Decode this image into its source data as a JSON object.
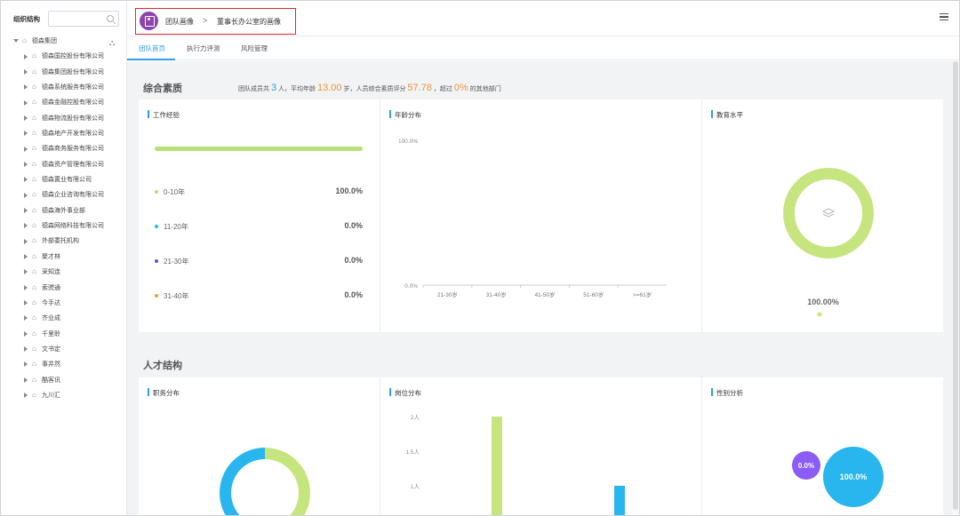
{
  "colors": {
    "accent": "#2aa0e6",
    "green": "#b8e079",
    "cyan": "#29b6ee",
    "purple": "#8b5cf6",
    "orange": "#f0a030",
    "avatar": "#8e44ad"
  },
  "sidebar": {
    "title": "组织结构",
    "search_placeholder": "",
    "root": "德森集团",
    "items": [
      "德森国控股份有限公司",
      "德森集团股份有限公司",
      "德森系统服务有限公司",
      "德森金融控股有限公司",
      "德森物流股份有限公司",
      "德森地产开发有限公司",
      "德森商务服务有限公司",
      "德森资产管理有限公司",
      "德森置业有限公司",
      "德森企业咨询有限公司",
      "德森海外事业部",
      "德森网络科技有限公司",
      "外部委托机构",
      "聚才林",
      "采知连",
      "索骋通",
      "今手达",
      "齐业成",
      "千里聆",
      "文书定",
      "事井然",
      "酷客讯",
      "九川汇"
    ]
  },
  "header": {
    "crumb1": "团队画像",
    "separator": ">",
    "crumb2": "董事长办公室的画像"
  },
  "tabs": [
    "团队首页",
    "执行力评测",
    "风险管理"
  ],
  "summary": {
    "section_title": "综合素质",
    "prefix": "团队成员共",
    "members": "3",
    "unit_members": "人，平均年龄",
    "avg_age": "13.00",
    "unit_age": "岁，人员综合素质评分",
    "score": "57.78",
    "mid": "，超过",
    "exceed": "0%",
    "suffix": "的其他部门"
  },
  "work_experience": {
    "title": "工作经验",
    "bar_fill_fraction": 1.0,
    "rows": [
      {
        "label": "0-10年",
        "value": "100.0%",
        "color": "#b8e079"
      },
      {
        "label": "11-20年",
        "value": "0.0%",
        "color": "#29b6ee"
      },
      {
        "label": "21-30年",
        "value": "0.0%",
        "color": "#6a4fc9"
      },
      {
        "label": "31-40年",
        "value": "0.0%",
        "color": "#f0a030"
      }
    ]
  },
  "chart_data": [
    {
      "type": "bar",
      "title": "年龄分布",
      "categories": [
        "21-30岁",
        "31-40岁",
        "41-50岁",
        "51-60岁",
        ">=61岁"
      ],
      "values": [
        0,
        0,
        0,
        0,
        0
      ],
      "y_ticks": [
        "100.0%",
        "0.0%"
      ],
      "ylim": [
        0,
        100
      ]
    },
    {
      "type": "pie",
      "title": "教育水平",
      "slices": [
        {
          "value": 100.0,
          "color": "#c7e57f"
        }
      ],
      "label": "100.00%"
    },
    {
      "type": "pie",
      "title": "职务分布",
      "slices": [
        {
          "value": 50,
          "color": "#c7e57f"
        },
        {
          "value": 50,
          "color": "#29b6ee"
        }
      ]
    },
    {
      "type": "bar",
      "title": "岗位分布",
      "y_ticks": [
        "2人",
        "1.5人",
        "1人"
      ],
      "ylim": [
        0,
        2
      ],
      "series": [
        {
          "values": [
            2
          ],
          "color": "#c7e57f"
        },
        {
          "values": [
            1
          ],
          "color": "#29b6ee"
        }
      ]
    },
    {
      "type": "bubble",
      "title": "性别分析",
      "bubbles": [
        {
          "label": "0.0%",
          "color": "#8b5cf6"
        },
        {
          "label": "100.0%",
          "color": "#29b6ee"
        }
      ]
    }
  ],
  "talent": {
    "section_title": "人才结构"
  }
}
